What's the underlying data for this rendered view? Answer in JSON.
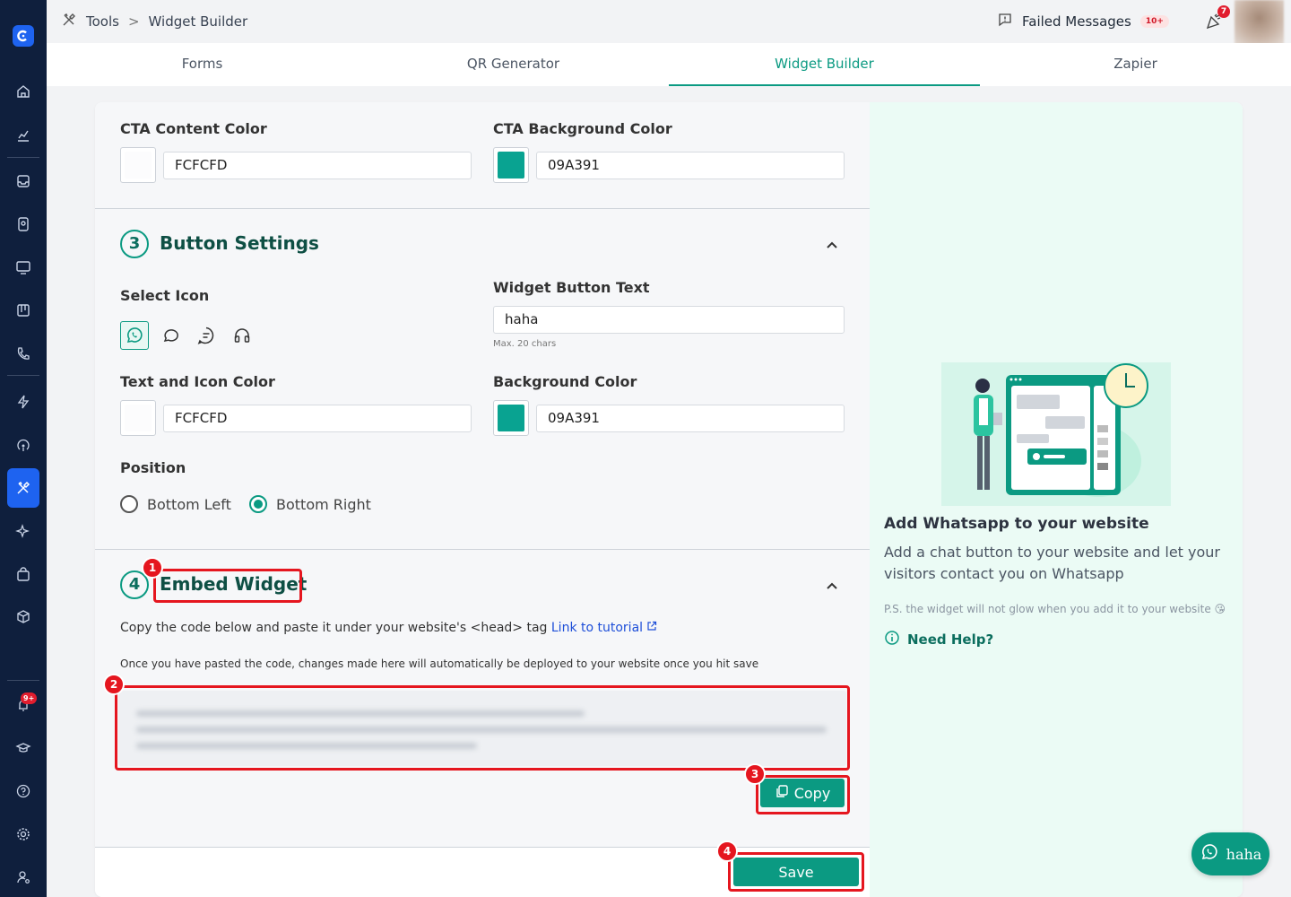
{
  "breadcrumb": {
    "root": "Tools",
    "separator": ">",
    "current": "Widget Builder"
  },
  "topbar": {
    "failed_label": "Failed Messages",
    "failed_badge": "10+",
    "notif_badge": "7"
  },
  "sidebar": {
    "alerts_badge": "9+"
  },
  "tabs": [
    {
      "label": "Forms"
    },
    {
      "label": "QR Generator"
    },
    {
      "label": "Widget Builder",
      "active": true
    },
    {
      "label": "Zapier"
    }
  ],
  "cta": {
    "content_color_label": "CTA Content Color",
    "content_color_value": "FCFCFD",
    "content_color_hex": "#FCFCFD",
    "bg_color_label": "CTA Background Color",
    "bg_color_value": "09A391",
    "bg_color_hex": "#09A391"
  },
  "button_settings": {
    "number": "3",
    "title": "Button Settings",
    "select_icon_label": "Select Icon",
    "icons": [
      "whatsapp-icon",
      "chat-bubble-icon",
      "message-lines-icon",
      "headset-icon"
    ],
    "widget_text_label": "Widget Button Text",
    "widget_text_value": "haha",
    "widget_text_hint": "Max. 20 chars",
    "text_icon_color_label": "Text and Icon Color",
    "text_icon_color_value": "FCFCFD",
    "bg_color_label": "Background Color",
    "bg_color_value": "09A391",
    "position_label": "Position",
    "position_options": [
      "Bottom Left",
      "Bottom Right"
    ],
    "position_selected": "Bottom Right"
  },
  "embed": {
    "number": "4",
    "title": "Embed Widget",
    "instruction": "Copy the code below and paste it under your website's <head> tag",
    "tutorial_link": "Link to tutorial",
    "deploy_note": "Once you have pasted the code, changes made here will automatically be deployed to your website once you hit save",
    "copy_label": "Copy"
  },
  "save_label": "Save",
  "annotations": [
    "1",
    "2",
    "3",
    "4"
  ],
  "preview": {
    "title": "Add Whatsapp to your website",
    "subtitle": "Add a chat button to your website and let your visitors contact you on Whatsapp",
    "ps": "P.S. the widget will not glow when you add it to your website 😘",
    "help": "Need Help?",
    "fab_label": "haha"
  },
  "colors": {
    "accent": "#0b9a82",
    "sidebar": "#0f1f3d",
    "annotation": "#e5161f"
  }
}
